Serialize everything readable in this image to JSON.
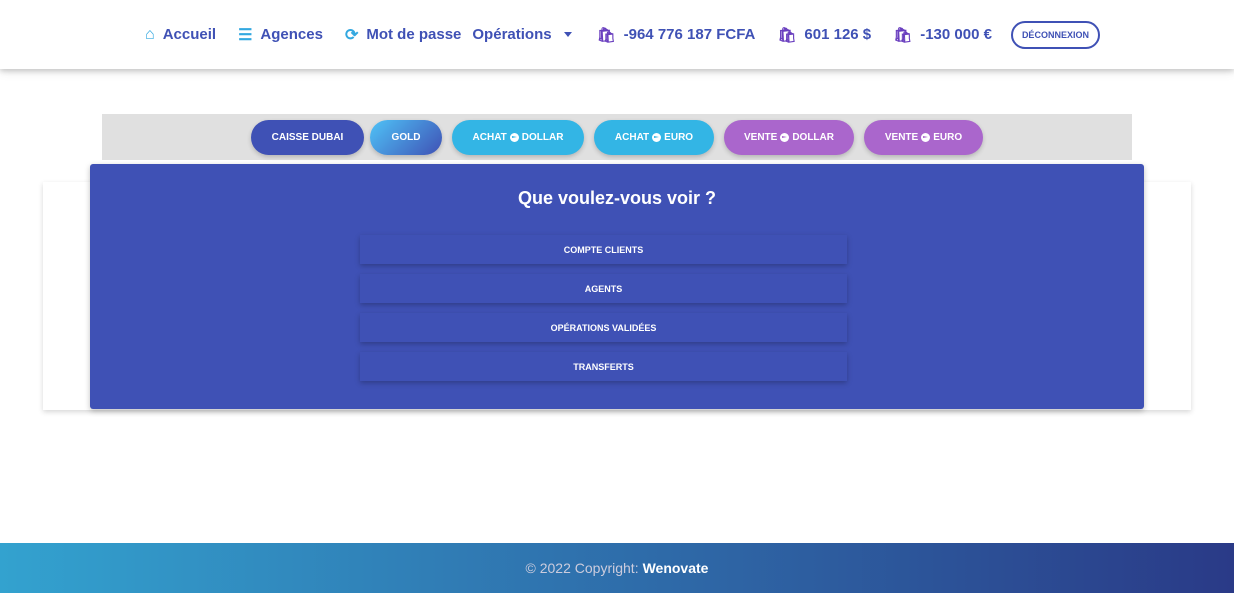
{
  "nav": {
    "home": "Accueil",
    "agencies": "Agences",
    "password": "Mot de passe",
    "operations": "Opérations",
    "balances": [
      "-964 776 187 FCFA",
      "601 126 $",
      "-130 000 €"
    ],
    "logout": "DÉCONNEXION"
  },
  "tabs": [
    {
      "pre": "CAISSE DUBAI",
      "post": "",
      "icon": false,
      "color": "#3f51b5"
    },
    {
      "pre": "GOLD",
      "post": "",
      "icon": false,
      "color": "gradient"
    },
    {
      "pre": "ACHAT",
      "post": "DOLLAR",
      "icon": true,
      "color": "#33b5e5"
    },
    {
      "pre": "ACHAT",
      "post": "EURO",
      "icon": true,
      "color": "#33b5e5"
    },
    {
      "pre": "VENTE",
      "post": "DOLLAR",
      "icon": true,
      "color": "#aa66cc"
    },
    {
      "pre": "VENTE",
      "post": "EURO",
      "icon": true,
      "color": "#aa66cc"
    }
  ],
  "panel": {
    "title": "Que voulez-vous voir ?",
    "options": [
      "COMPTE CLIENTS",
      "AGENTS",
      "OPÉRATIONS VALIDÉES",
      "TRANSFERTS"
    ]
  },
  "footer": {
    "copyright": "© 2022 Copyright:",
    "brand": "Wenovate"
  }
}
